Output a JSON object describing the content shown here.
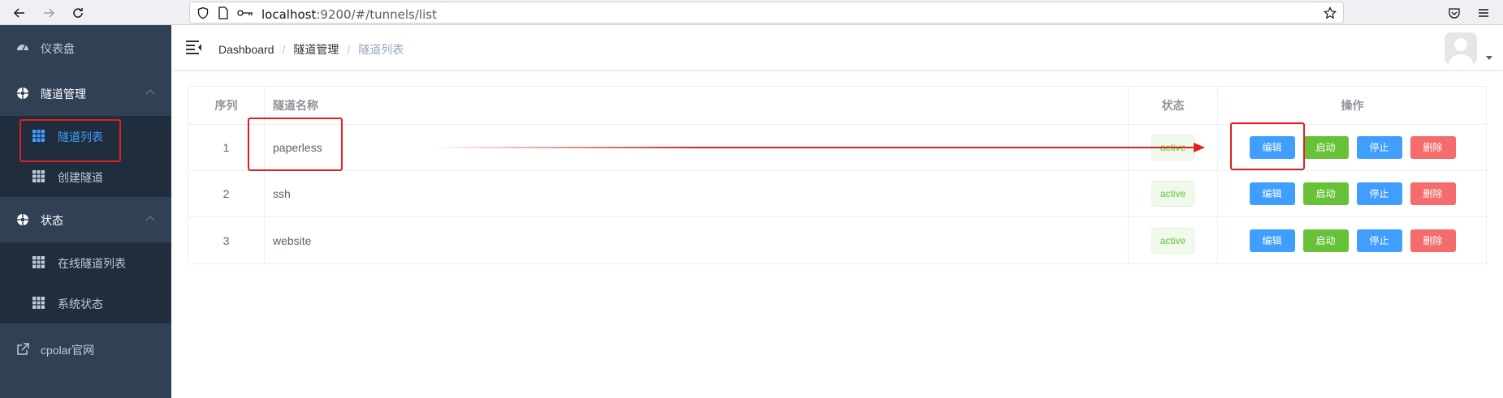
{
  "browser": {
    "url_host": "localhost",
    "url_rest": ":9200/#/tunnels/list"
  },
  "sidebar": {
    "items": [
      {
        "label": "仪表盘",
        "icon": "dashboard-icon"
      },
      {
        "label": "隧道管理",
        "icon": "tunnel-manage-icon",
        "expanded": true,
        "children": [
          {
            "label": "隧道列表",
            "icon": "table-icon",
            "active": true
          },
          {
            "label": "创建隧道",
            "icon": "table-icon"
          }
        ]
      },
      {
        "label": "状态",
        "icon": "status-icon",
        "expanded": true,
        "children": [
          {
            "label": "在线隧道列表",
            "icon": "table-icon"
          },
          {
            "label": "系统状态",
            "icon": "table-icon"
          }
        ]
      },
      {
        "label": "cpolar官网",
        "icon": "external-link-icon"
      }
    ]
  },
  "breadcrumb": {
    "items": [
      "Dashboard",
      "隧道管理",
      "隧道列表"
    ],
    "separator": "/"
  },
  "table": {
    "headers": [
      "序列",
      "隧道名称",
      "状态",
      "操作"
    ],
    "rows": [
      {
        "index": "1",
        "name": "paperless",
        "status": "active"
      },
      {
        "index": "2",
        "name": "ssh",
        "status": "active"
      },
      {
        "index": "3",
        "name": "website",
        "status": "active"
      }
    ],
    "actions": [
      "编辑",
      "启动",
      "停止",
      "删除"
    ]
  },
  "colors": {
    "sidebar_bg": "#304156",
    "sidebar_sub_bg": "#1f2d3d",
    "active_text": "#409eff",
    "primary": "#409eff",
    "success": "#67c23a",
    "danger": "#f56c6c",
    "annotation": "#e02020"
  }
}
